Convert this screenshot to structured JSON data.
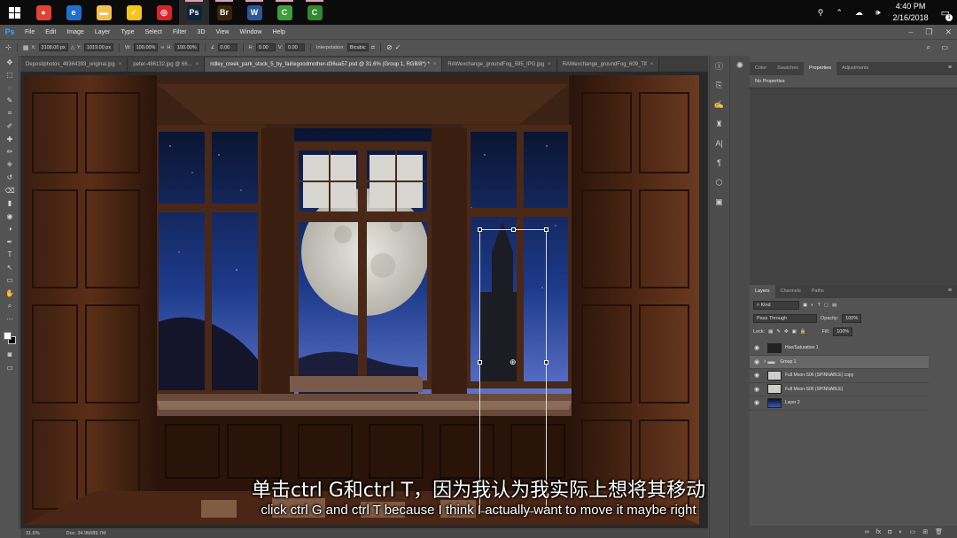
{
  "taskbar": {
    "apps": [
      {
        "name": "chrome-icon",
        "color": "#e34133",
        "glyph": "●",
        "running": false
      },
      {
        "name": "edge-icon",
        "color": "#1f6fd1",
        "glyph": "e",
        "running": false
      },
      {
        "name": "file-explorer-icon",
        "color": "#f2c14e",
        "glyph": "▬",
        "running": false
      },
      {
        "name": "norton-icon",
        "color": "#f5c518",
        "glyph": "✓",
        "running": false
      },
      {
        "name": "creative-cloud-icon",
        "color": "#d8232a",
        "glyph": "◎",
        "running": false
      },
      {
        "name": "photoshop-icon",
        "color": "#0d2438",
        "glyph": "Ps",
        "running": true
      },
      {
        "name": "bridge-icon",
        "color": "#3a2506",
        "glyph": "Br",
        "running": true
      },
      {
        "name": "word-icon",
        "color": "#2b579a",
        "glyph": "W",
        "running": true
      },
      {
        "name": "camtasia-icon",
        "color": "#3d9e3a",
        "glyph": "C",
        "running": true
      },
      {
        "name": "camtasia-recorder-icon",
        "color": "#2e8b2e",
        "glyph": "C",
        "running": true
      }
    ],
    "time": "4:40 PM",
    "date": "2/16/2018",
    "notification_count": "1"
  },
  "menubar": {
    "logo": "Ps",
    "items": [
      "File",
      "Edit",
      "Image",
      "Layer",
      "Type",
      "Select",
      "Filter",
      "3D",
      "View",
      "Window",
      "Help"
    ]
  },
  "options": {
    "x_label": "X:",
    "x_value": "3108.00 px",
    "y_label": "Y:",
    "y_value": "1019.00 px",
    "w_label": "W:",
    "w_value": "100.00%",
    "h_label": "H:",
    "h_value": "100.00%",
    "angle_value": "0.00",
    "hskew_label": "H:",
    "hskew_value": "0.00",
    "vskew_label": "V:",
    "vskew_value": "0.00",
    "interp_label": "Interpolation:",
    "interp_value": "Bicubic"
  },
  "tabs": [
    {
      "label": "Depositphotos_49364393_original.jpg",
      "active": false
    },
    {
      "label": "peter-486132.jpg @ 66...",
      "active": false
    },
    {
      "label": "ridley_creek_park_stock_5_by_fairiegoodmother-d36ua57.psd @ 31.6% (Group 1, RGB/8*) *",
      "active": true
    },
    {
      "label": "RAWexchange_groundFog_595_IPG.jpg",
      "active": false
    },
    {
      "label": "RAWexchange_groundFog_609_Tif",
      "active": false
    }
  ],
  "status": {
    "zoom": "31.6%",
    "doc": "Doc: 34.9M/89.7M"
  },
  "properties": {
    "tabs": [
      "Color",
      "Swatches",
      "Properties",
      "Adjustments"
    ],
    "active_tab": "Properties",
    "title": "No Properties"
  },
  "layers_panel": {
    "tabs": [
      "Layers",
      "Channels",
      "Paths"
    ],
    "filter": "Kind",
    "blend_mode": "Pass Through",
    "opacity_label": "Opacity:",
    "opacity_value": "100%",
    "lock_label": "Lock:",
    "fill_label": "Fill:",
    "fill_value": "100%",
    "layers": [
      {
        "name": "Hue/Saturation 1",
        "type": "adjustment",
        "selected": false
      },
      {
        "name": "Group 1",
        "type": "group",
        "selected": true
      },
      {
        "name": "Full Moon-S06 (SPINNABLE) copy",
        "type": "image",
        "selected": false
      },
      {
        "name": "Full Moon-S06 (SPINNABLE)",
        "type": "image",
        "selected": false
      },
      {
        "name": "Layer 2",
        "type": "sky",
        "selected": false
      }
    ]
  },
  "subtitles": {
    "zh": "单击ctrl G和ctrl T，因为我认为我实际上想将其移动",
    "en": "click ctrl G and ctrl T because I think I actually want to move it maybe right"
  }
}
